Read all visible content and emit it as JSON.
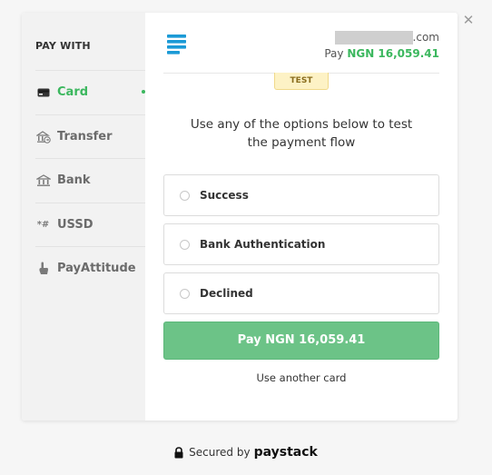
{
  "close": {
    "icon": "close-icon",
    "glyph": "✕"
  },
  "sidebar": {
    "heading": "PAY WITH",
    "items": [
      {
        "label": "Card",
        "icon": "card-icon",
        "active": true
      },
      {
        "label": "Transfer",
        "icon": "transfer-icon",
        "active": false
      },
      {
        "label": "Bank",
        "icon": "bank-icon",
        "active": false
      },
      {
        "label": "USSD",
        "icon": "ussd-icon",
        "glyph": "*#",
        "active": false
      },
      {
        "label": "PayAttitude",
        "icon": "hand-tap-icon",
        "active": false
      }
    ]
  },
  "header": {
    "logo_icon": "paystack-logo-icon",
    "email_suffix": ".com",
    "pay_prefix": "Pay",
    "amount": "NGN 16,059.41"
  },
  "badge": "TEST",
  "instructions": {
    "line1": "Use any of the options below to test",
    "line2": "the payment flow"
  },
  "options": [
    {
      "label": "Success"
    },
    {
      "label": "Bank Authentication"
    },
    {
      "label": "Declined"
    }
  ],
  "pay_button": "Pay NGN 16,059.41",
  "another_card": "Use another card",
  "footer": {
    "secured_text": "Secured by",
    "brand": "paystack",
    "lock_icon": "lock-icon"
  },
  "colors": {
    "accent": "#3bb75e",
    "pay_button": "#6cc387",
    "badge_bg": "#fdf2c5",
    "logo": "#1b9ad6"
  }
}
